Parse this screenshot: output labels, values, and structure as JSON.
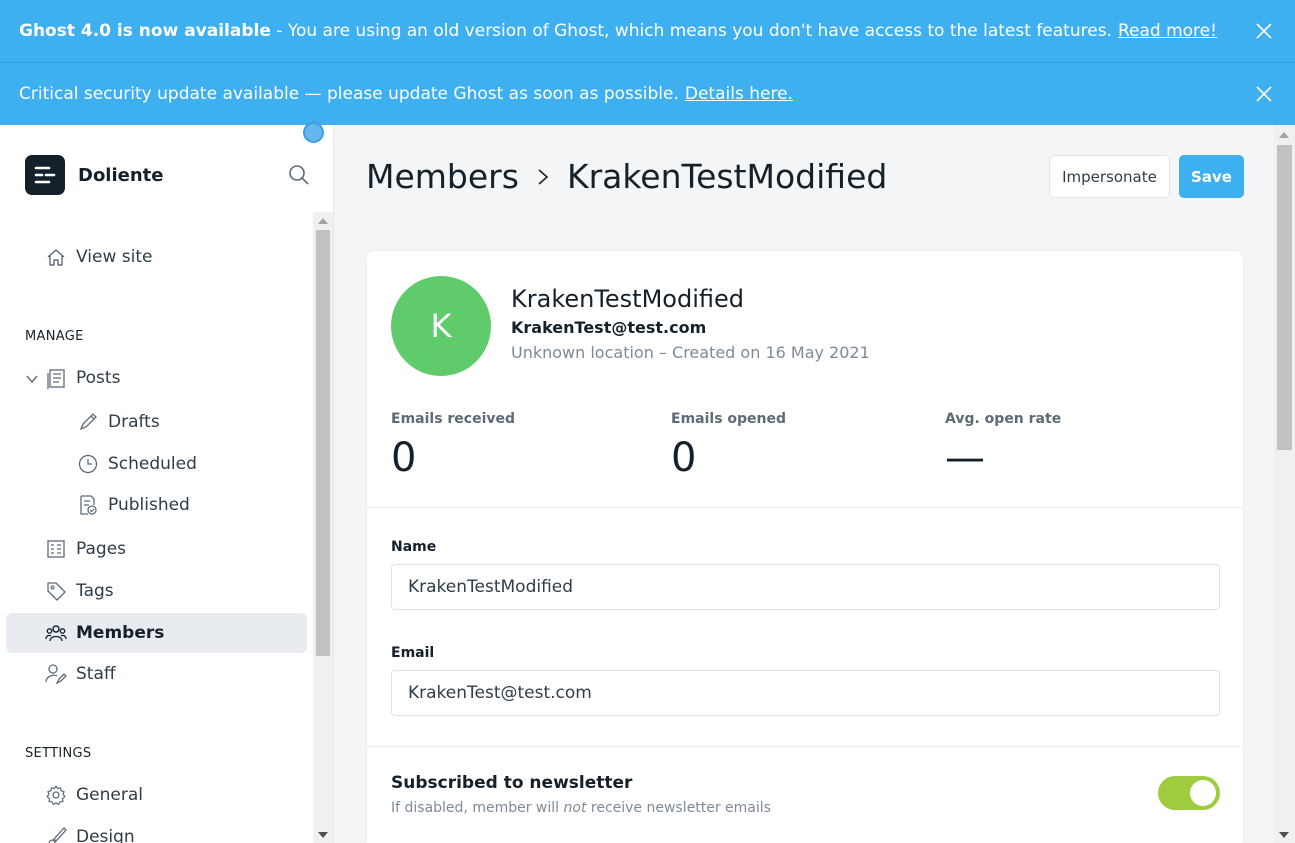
{
  "banners": {
    "upgrade": {
      "bold": "Ghost 4.0 is now available",
      "text": " - You are using an old version of Ghost, which means you don't have access to the latest features.",
      "link": "Read more!"
    },
    "security": {
      "text": "Critical security update available — please update Ghost as soon as possible.",
      "link": "Details here."
    }
  },
  "sidebar": {
    "site_name": "Doliente",
    "view_site": "View site",
    "manage_label": "MANAGE",
    "posts": "Posts",
    "drafts": "Drafts",
    "scheduled": "Scheduled",
    "published": "Published",
    "pages": "Pages",
    "tags": "Tags",
    "members": "Members",
    "staff": "Staff",
    "settings_label": "SETTINGS",
    "general": "General",
    "design": "Design"
  },
  "header": {
    "crumb": "Members",
    "title": "KrakenTestModified",
    "impersonate": "Impersonate",
    "save": "Save"
  },
  "member": {
    "initial": "K",
    "name": "KrakenTestModified",
    "email": "KrakenTest@test.com",
    "meta": "Unknown location – Created on 16 May 2021"
  },
  "stats": {
    "received_label": "Emails received",
    "received_value": "0",
    "opened_label": "Emails opened",
    "opened_value": "0",
    "rate_label": "Avg. open rate",
    "rate_value": "—"
  },
  "form": {
    "name_label": "Name",
    "name_value": "KrakenTestModified",
    "email_label": "Email",
    "email_value": "KrakenTest@test.com"
  },
  "newsletter": {
    "title": "Subscribed to newsletter",
    "desc_before": "If disabled, member will ",
    "desc_em": "not",
    "desc_after": " receive newsletter emails",
    "enabled": true
  },
  "colors": {
    "banner": "#3eb0ef",
    "save_button": "#3eb0ef",
    "avatar": "#5fcb6b",
    "toggle_on": "#9fcc3f",
    "text_dark": "#15212a",
    "text_muted": "#7c8b9a"
  }
}
